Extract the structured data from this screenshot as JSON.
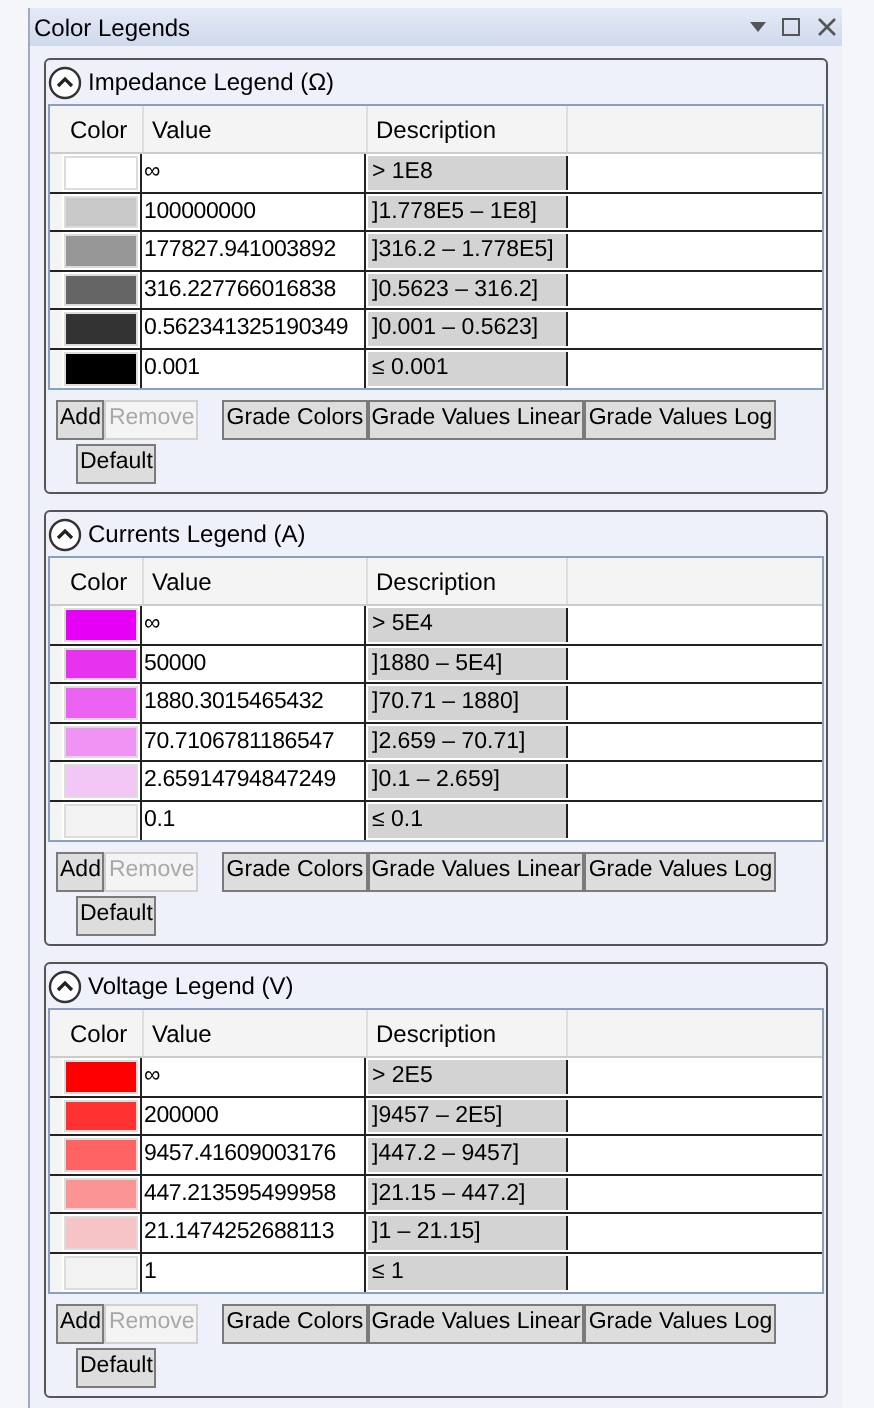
{
  "window": {
    "title": "Color Legends"
  },
  "legends": [
    {
      "title": "Impedance Legend (Ω)",
      "expanded": true,
      "columns": [
        "Color",
        "Value",
        "Description"
      ],
      "rows": [
        {
          "color": "#ffffff",
          "value": "∞",
          "description": "> 1E8"
        },
        {
          "color": "#c8c8c8",
          "value": "100000000",
          "description": "]1.778E5 – 1E8]"
        },
        {
          "color": "#969696",
          "value": "177827.941003892",
          "description": "]316.2 – 1.778E5]"
        },
        {
          "color": "#646464",
          "value": "316.227766016838",
          "description": "]0.5623 – 316.2]"
        },
        {
          "color": "#323232",
          "value": "0.562341325190349",
          "description": "]0.001 – 0.5623]"
        },
        {
          "color": "#000000",
          "value": "0.001",
          "description": "≤ 0.001"
        }
      ],
      "buttons": [
        {
          "label": "Add",
          "disabled": false
        },
        {
          "label": "Remove",
          "disabled": true
        },
        {
          "label": "Grade Colors",
          "disabled": false
        },
        {
          "label": "Grade Values Linear",
          "disabled": false
        },
        {
          "label": "Grade Values Log",
          "disabled": false
        },
        {
          "label": "Default",
          "disabled": false
        }
      ]
    },
    {
      "title": "Currents Legend (A)",
      "expanded": true,
      "columns": [
        "Color",
        "Value",
        "Description"
      ],
      "rows": [
        {
          "color": "#e600f5",
          "value": "∞",
          "description": "> 5E4"
        },
        {
          "color": "#e733ef",
          "value": "50000",
          "description": "]1880 – 5E4]"
        },
        {
          "color": "#eb62f2",
          "value": "1880.3015465432",
          "description": "]70.71 – 1880]"
        },
        {
          "color": "#ef93f4",
          "value": "70.7106781186547",
          "description": "]2.659 – 70.71]"
        },
        {
          "color": "#f2c6f5",
          "value": "2.65914794847249",
          "description": "]0.1 – 2.659]"
        },
        {
          "color": "#f3f3f3",
          "value": "0.1",
          "description": "≤ 0.1"
        }
      ],
      "buttons": [
        {
          "label": "Add",
          "disabled": false
        },
        {
          "label": "Remove",
          "disabled": true
        },
        {
          "label": "Grade Colors",
          "disabled": false
        },
        {
          "label": "Grade Values Linear",
          "disabled": false
        },
        {
          "label": "Grade Values Log",
          "disabled": false
        },
        {
          "label": "Default",
          "disabled": false
        }
      ]
    },
    {
      "title": "Voltage Legend (V)",
      "expanded": true,
      "columns": [
        "Color",
        "Value",
        "Description"
      ],
      "rows": [
        {
          "color": "#ff0000",
          "value": "∞",
          "description": "> 2E5"
        },
        {
          "color": "#ff3232",
          "value": "200000",
          "description": "]9457 – 2E5]"
        },
        {
          "color": "#ff6262",
          "value": "9457.41609003176",
          "description": "]447.2 – 9457]"
        },
        {
          "color": "#fb9494",
          "value": "447.213595499958",
          "description": "]21.15 – 447.2]"
        },
        {
          "color": "#f6c4c4",
          "value": "21.1474252688113",
          "description": "]1 – 21.15]"
        },
        {
          "color": "#f3f3f3",
          "value": "1",
          "description": "≤ 1"
        }
      ],
      "buttons": [
        {
          "label": "Add",
          "disabled": false
        },
        {
          "label": "Remove",
          "disabled": true
        },
        {
          "label": "Grade Colors",
          "disabled": false
        },
        {
          "label": "Grade Values Linear",
          "disabled": false
        },
        {
          "label": "Grade Values Log",
          "disabled": false
        },
        {
          "label": "Default",
          "disabled": false
        }
      ]
    }
  ]
}
